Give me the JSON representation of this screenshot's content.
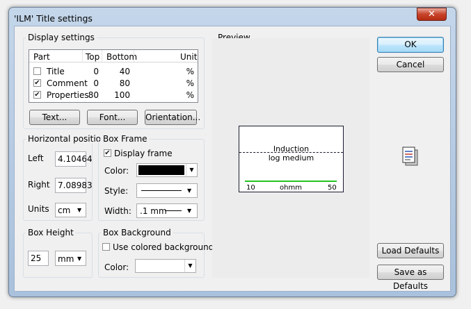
{
  "window": {
    "title": "'ILM' Title settings",
    "close_glyph": "✕"
  },
  "display_settings": {
    "label": "Display settings",
    "headers": {
      "part": "Part",
      "top": "Top",
      "bottom": "Bottom",
      "unit": "Unit"
    },
    "rows": [
      {
        "checked": false,
        "part": "Title",
        "top": "0",
        "bottom": "40",
        "unit": "%"
      },
      {
        "checked": true,
        "part": "Comment",
        "top": "0",
        "bottom": "80",
        "unit": "%"
      },
      {
        "checked": true,
        "part": "Properties",
        "top": "80",
        "bottom": "100",
        "unit": "%"
      }
    ],
    "buttons": {
      "text": "Text...",
      "font": "Font...",
      "orientation": "Orientation..."
    }
  },
  "horizontal_position": {
    "label": "Horizontal position",
    "left_label": "Left",
    "left_value": "4.10464",
    "right_label": "Right",
    "right_value": "7.08983",
    "units_label": "Units",
    "units_value": "cm"
  },
  "box_frame": {
    "label": "Box Frame",
    "display_frame_label": "Display frame",
    "display_frame_checked": true,
    "color_label": "Color:",
    "color_value": "#000000",
    "style_label": "Style:",
    "width_label": "Width:",
    "width_value": ".1 mm"
  },
  "box_height": {
    "label": "Box Height",
    "value": "25",
    "unit": "mm"
  },
  "box_background": {
    "label": "Box Background",
    "use_colored_label": "Use colored background",
    "use_colored_checked": false,
    "color_label": "Color:",
    "color_value": "#ffffff"
  },
  "preview": {
    "label": "Preview",
    "line1": "Induction",
    "line2": "log medium",
    "scale_min": "10",
    "scale_unit": "ohmm",
    "scale_max": "50",
    "curve_color": "#22c41f"
  },
  "actions": {
    "ok": "OK",
    "cancel": "Cancel",
    "load_defaults": "Load Defaults",
    "save_defaults": "Save as Defaults"
  },
  "icons": {
    "check": "✔",
    "arrow": "▼"
  }
}
